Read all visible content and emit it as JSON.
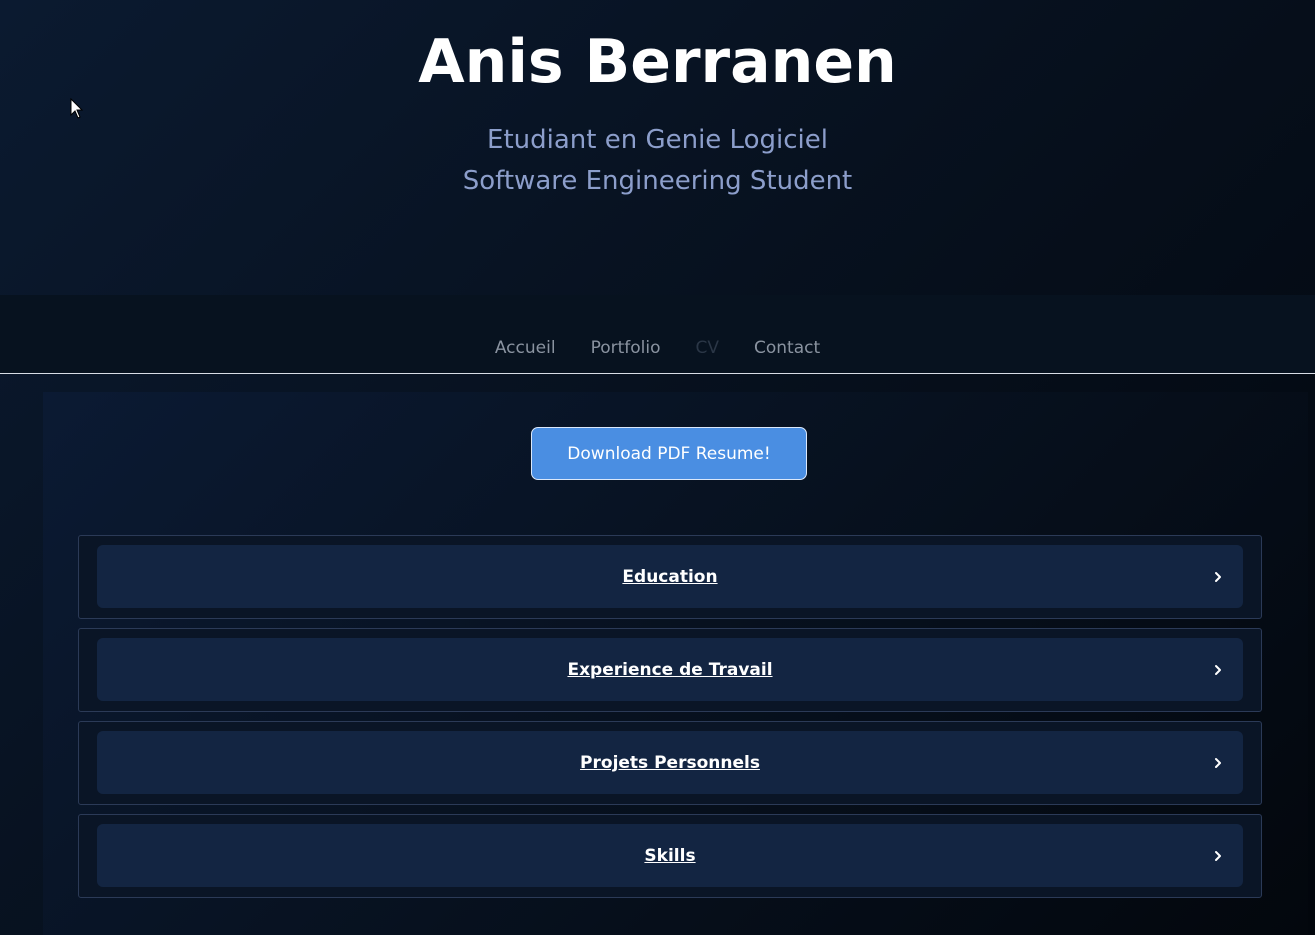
{
  "header": {
    "name": "Anis Berranen",
    "subtitle_fr": "Etudiant en Genie Logiciel",
    "subtitle_en": "Software Engineering Student"
  },
  "nav": {
    "items": [
      {
        "label": "Accueil",
        "active": false
      },
      {
        "label": "Portfolio",
        "active": false
      },
      {
        "label": "CV",
        "active": true
      },
      {
        "label": "Contact",
        "active": false
      }
    ]
  },
  "main": {
    "download_label": "Download PDF Resume!",
    "sections": [
      {
        "label": "Education",
        "icon": "chevron-right-icon"
      },
      {
        "label": "Experience de Travail",
        "icon": "chevron-right-icon"
      },
      {
        "label": "Projets Personnels",
        "icon": "chevron-right-icon"
      },
      {
        "label": "Skills",
        "icon": "chevron-right-icon"
      }
    ]
  },
  "colors": {
    "accent": "#4a8ee2",
    "subtitle": "#8c9ecb",
    "section_bg": "#132542"
  }
}
